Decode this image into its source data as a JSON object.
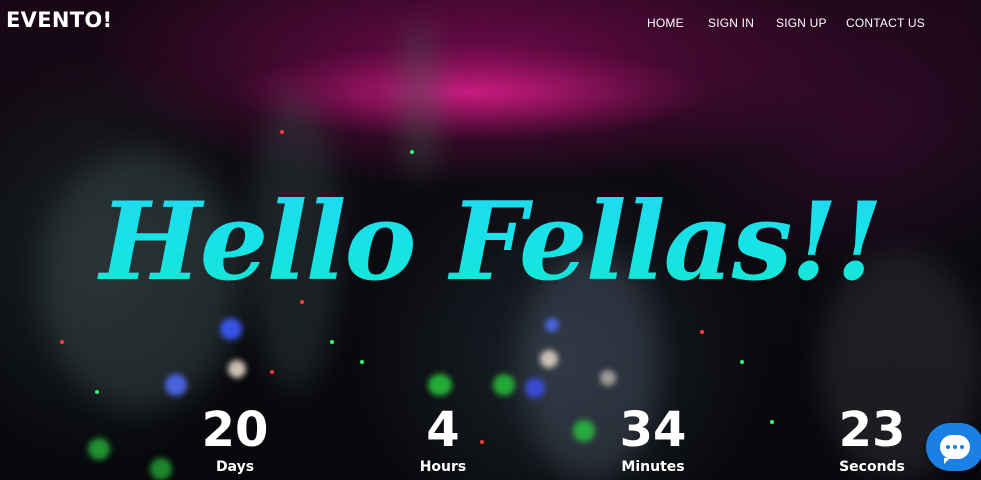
{
  "brand": {
    "logo": "EVENTO!"
  },
  "nav": {
    "items": [
      {
        "label": "HOME"
      },
      {
        "label": "SIGN IN"
      },
      {
        "label": "SIGN UP"
      },
      {
        "label": "CONTACT US"
      }
    ]
  },
  "hero": {
    "headline": "Hello Fellas!!",
    "headline_colors": [
      "#22d6f2",
      "#12e8c8"
    ]
  },
  "countdown": {
    "days": {
      "value": "20",
      "label": "Days"
    },
    "hours": {
      "value": "4",
      "label": "Hours"
    },
    "minutes": {
      "value": "34",
      "label": "Minutes"
    },
    "seconds": {
      "value": "23",
      "label": "Seconds"
    }
  },
  "chat": {
    "icon": "chat-bubble-icon",
    "color": "#1a7fe6"
  }
}
